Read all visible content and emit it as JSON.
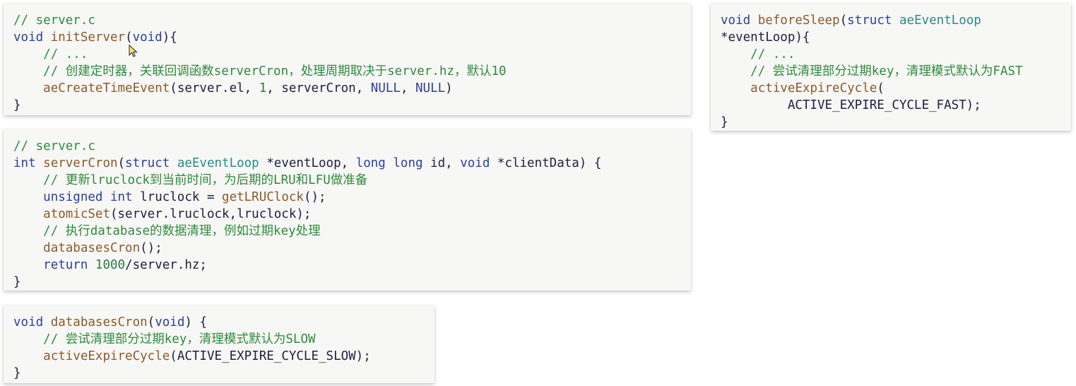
{
  "code_blocks": [
    {
      "id": "initserver",
      "lines": [
        [
          {
            "t": "cmt",
            "v": "// server.c"
          }
        ],
        [
          {
            "t": "kw",
            "v": "void"
          },
          {
            "t": "txt",
            "v": " "
          },
          {
            "t": "fn",
            "v": "initServer"
          },
          {
            "t": "txt",
            "v": "("
          },
          {
            "t": "kw",
            "v": "void"
          },
          {
            "t": "txt",
            "v": "){"
          }
        ],
        [
          {
            "t": "txt",
            "v": "    "
          },
          {
            "t": "cmt",
            "v": "// ..."
          }
        ],
        [
          {
            "t": "txt",
            "v": "    "
          },
          {
            "t": "cmt",
            "v": "// 创建定时器，关联回调函数serverCron，处理周期取决于server.hz，默认10"
          }
        ],
        [
          {
            "t": "txt",
            "v": "    "
          },
          {
            "t": "fn",
            "v": "aeCreateTimeEvent"
          },
          {
            "t": "txt",
            "v": "(server.el, "
          },
          {
            "t": "num",
            "v": "1"
          },
          {
            "t": "txt",
            "v": ", serverCron, "
          },
          {
            "t": "const",
            "v": "NULL"
          },
          {
            "t": "txt",
            "v": ", "
          },
          {
            "t": "const",
            "v": "NULL"
          },
          {
            "t": "txt",
            "v": ")"
          }
        ],
        [
          {
            "t": "txt",
            "v": "}"
          }
        ]
      ]
    },
    {
      "id": "servercron",
      "lines": [
        [
          {
            "t": "cmt",
            "v": "// server.c"
          }
        ],
        [
          {
            "t": "kw",
            "v": "int"
          },
          {
            "t": "txt",
            "v": " "
          },
          {
            "t": "fn",
            "v": "serverCron"
          },
          {
            "t": "txt",
            "v": "("
          },
          {
            "t": "kw",
            "v": "struct"
          },
          {
            "t": "txt",
            "v": " "
          },
          {
            "t": "struct",
            "v": "aeEventLoop"
          },
          {
            "t": "txt",
            "v": " *eventLoop, "
          },
          {
            "t": "kw",
            "v": "long long"
          },
          {
            "t": "txt",
            "v": " id, "
          },
          {
            "t": "kw",
            "v": "void"
          },
          {
            "t": "txt",
            "v": " *clientData) {"
          }
        ],
        [
          {
            "t": "txt",
            "v": "    "
          },
          {
            "t": "cmt",
            "v": "// 更新lruclock到当前时间，为后期的LRU和LFU做准备"
          }
        ],
        [
          {
            "t": "txt",
            "v": "    "
          },
          {
            "t": "kw",
            "v": "unsigned int"
          },
          {
            "t": "txt",
            "v": " lruclock = "
          },
          {
            "t": "fn",
            "v": "getLRUClock"
          },
          {
            "t": "txt",
            "v": "();"
          }
        ],
        [
          {
            "t": "txt",
            "v": "    "
          },
          {
            "t": "fn",
            "v": "atomicSet"
          },
          {
            "t": "txt",
            "v": "(server.lruclock,lruclock);"
          }
        ],
        [
          {
            "t": "txt",
            "v": "    "
          },
          {
            "t": "cmt",
            "v": "// 执行database的数据清理，例如过期key处理"
          }
        ],
        [
          {
            "t": "txt",
            "v": "    "
          },
          {
            "t": "fn",
            "v": "databasesCron"
          },
          {
            "t": "txt",
            "v": "();"
          }
        ],
        [
          {
            "t": "txt",
            "v": "    "
          },
          {
            "t": "kw",
            "v": "return"
          },
          {
            "t": "txt",
            "v": " "
          },
          {
            "t": "num",
            "v": "1000"
          },
          {
            "t": "txt",
            "v": "/server.hz;"
          }
        ],
        [
          {
            "t": "txt",
            "v": "}"
          }
        ]
      ]
    },
    {
      "id": "databasescron",
      "lines": [
        [
          {
            "t": "kw",
            "v": "void"
          },
          {
            "t": "txt",
            "v": " "
          },
          {
            "t": "fn",
            "v": "databasesCron"
          },
          {
            "t": "txt",
            "v": "("
          },
          {
            "t": "kw",
            "v": "void"
          },
          {
            "t": "txt",
            "v": ") {"
          }
        ],
        [
          {
            "t": "txt",
            "v": "    "
          },
          {
            "t": "cmt",
            "v": "// 尝试清理部分过期key，清理模式默认为SLOW"
          }
        ],
        [
          {
            "t": "txt",
            "v": "    "
          },
          {
            "t": "fn",
            "v": "activeExpireCycle"
          },
          {
            "t": "txt",
            "v": "(ACTIVE_EXPIRE_CYCLE_SLOW);"
          }
        ],
        [
          {
            "t": "txt",
            "v": "}"
          }
        ]
      ]
    },
    {
      "id": "beforesleep",
      "lines": [
        [
          {
            "t": "kw",
            "v": "void"
          },
          {
            "t": "txt",
            "v": " "
          },
          {
            "t": "fn",
            "v": "beforeSleep"
          },
          {
            "t": "txt",
            "v": "("
          },
          {
            "t": "kw",
            "v": "struct"
          },
          {
            "t": "txt",
            "v": " "
          },
          {
            "t": "struct",
            "v": "aeEventLoop"
          }
        ],
        [
          {
            "t": "txt",
            "v": "*eventLoop){"
          }
        ],
        [
          {
            "t": "txt",
            "v": "    "
          },
          {
            "t": "cmt",
            "v": "// ..."
          }
        ],
        [
          {
            "t": "txt",
            "v": "    "
          },
          {
            "t": "cmt",
            "v": "// 尝试清理部分过期key，清理模式默认为FAST"
          }
        ],
        [
          {
            "t": "txt",
            "v": "    "
          },
          {
            "t": "fn",
            "v": "activeExpireCycle"
          },
          {
            "t": "txt",
            "v": "("
          }
        ],
        [
          {
            "t": "txt",
            "v": "         ACTIVE_EXPIRE_CYCLE_FAST);"
          }
        ],
        [
          {
            "t": "txt",
            "v": "}"
          }
        ]
      ]
    }
  ],
  "colors": {
    "keyword": "#2d3f9a",
    "function": "#8b5a2b",
    "comment": "#2e8b3d",
    "number": "#2f7a3e",
    "struct": "#2a8a8a",
    "text": "#202040",
    "card_background": "#f7f7f5"
  },
  "icons": {
    "cursor": "mouse-pointer-icon"
  }
}
